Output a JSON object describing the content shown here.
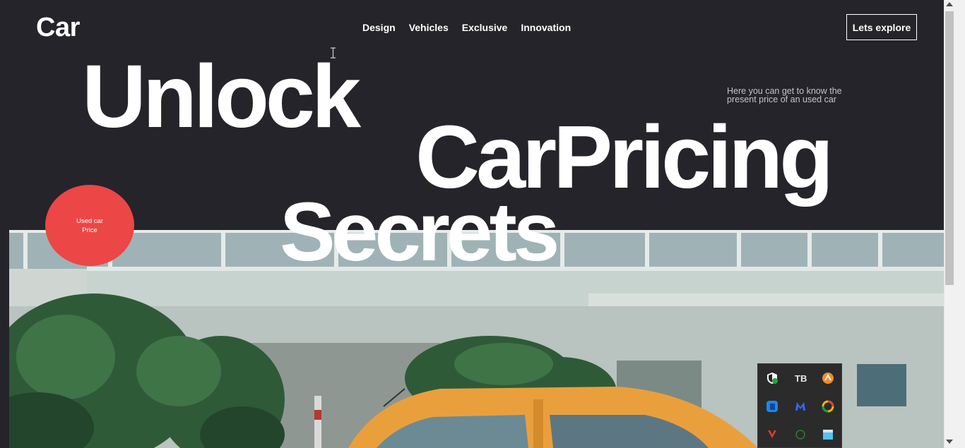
{
  "header": {
    "logo": "Car",
    "nav": [
      "Design",
      "Vehicles",
      "Exclusive",
      "Innovation"
    ],
    "cta_label": "Lets explore"
  },
  "hero": {
    "word1": "Unlock",
    "word2": "CarPricing",
    "word3": "Secrets",
    "tagline": "Here you can get to know the present price of an used car",
    "badge_line1": "Used car",
    "badge_line2": "Price"
  },
  "colors": {
    "background": "#25242a",
    "badge": "#ec4646",
    "car": "#e9a03c"
  },
  "tray_icons": [
    "shield-check-icon",
    "tb-icon",
    "orange-app-icon",
    "blue-app-icon",
    "malwarebytes-icon",
    "color-ring-icon",
    "red-arrow-icon",
    "circle-icon",
    "window-icon"
  ]
}
